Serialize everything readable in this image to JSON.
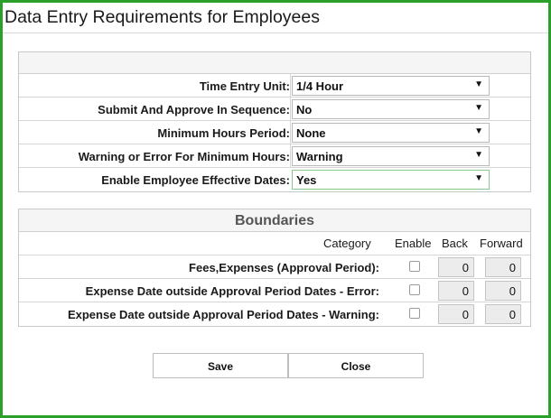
{
  "dialog": {
    "title": "Data Entry Requirements for Employees"
  },
  "settings": [
    {
      "label": "Time Entry Unit:",
      "value": "1/4 Hour"
    },
    {
      "label": "Submit And Approve In Sequence:",
      "value": "No"
    },
    {
      "label": "Minimum Hours Period:",
      "value": "None"
    },
    {
      "label": "Warning or Error For Minimum Hours:",
      "value": "Warning"
    },
    {
      "label": "Enable Employee Effective Dates:",
      "value": "Yes"
    }
  ],
  "highlight_color": "#5aff5a",
  "frame_color": "#2aa02a",
  "boundaries": {
    "title": "Boundaries",
    "headers": {
      "category": "Category",
      "enable": "Enable",
      "back": "Back",
      "forward": "Forward"
    },
    "rows": [
      {
        "label": "Fees,Expenses (Approval Period):",
        "enabled": false,
        "back": "0",
        "forward": "0"
      },
      {
        "label": "Expense Date outside Approval Period Dates - Error:",
        "enabled": false,
        "back": "0",
        "forward": "0"
      },
      {
        "label": "Expense Date outside Approval Period Dates - Warning:",
        "enabled": false,
        "back": "0",
        "forward": "0"
      }
    ]
  },
  "buttons": {
    "save": "Save",
    "close": "Close"
  },
  "icons": {
    "dropdown": "chevron-down-icon"
  }
}
